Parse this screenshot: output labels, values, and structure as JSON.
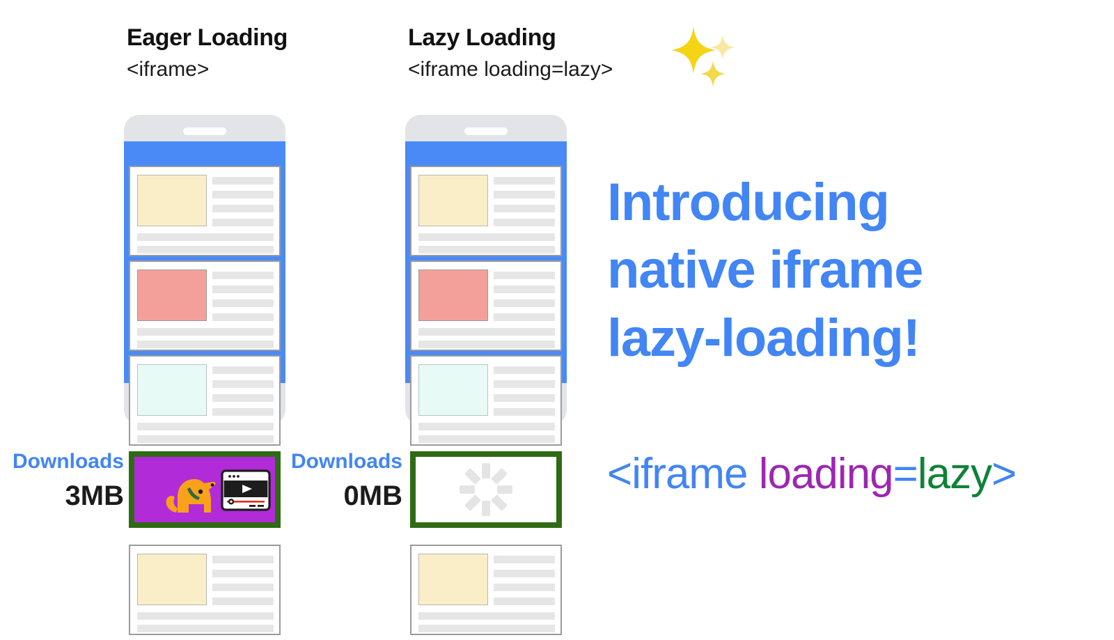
{
  "columns": [
    {
      "id": "eager",
      "title": "Eager Loading",
      "subtitle": "<iframe>",
      "downloads_label": "Downloads",
      "downloads_value": "3MB",
      "embed_type": "video-thumbnail"
    },
    {
      "id": "lazy",
      "title": "Lazy Loading",
      "subtitle": "<iframe loading=lazy>",
      "downloads_label": "Downloads",
      "downloads_value": "0MB",
      "embed_type": "loading-spinner"
    }
  ],
  "sparkle_icon": "sparkles-emoji",
  "headline": "Introducing native iframe lazy-loading!",
  "code": {
    "tag_open": "<iframe",
    "attribute": " loading",
    "equals": "=",
    "value": "lazy",
    "tag_close": ">"
  },
  "cards": [
    {
      "thumb": "cream"
    },
    {
      "thumb": "salmon"
    },
    {
      "thumb": "mint"
    },
    {
      "thumb": "cream"
    }
  ],
  "colors": {
    "accent_blue": "#4285f4",
    "screen_blue": "#4a8af6",
    "phone_gray": "#e2e4e8",
    "embed_border_green": "#2e6b14",
    "video_purple": "#b22bd8",
    "dog_orange": "#f9a11b",
    "player_red": "#e8291c",
    "thumb_cream": "#faeec9",
    "thumb_salmon": "#f4a09a",
    "thumb_mint": "#e8faf5",
    "placeholder_gray": "#e6e6e6"
  },
  "video_thumbnail": {
    "dog_icon": "dog-illustration",
    "player_icon": "video-player-illustration"
  }
}
